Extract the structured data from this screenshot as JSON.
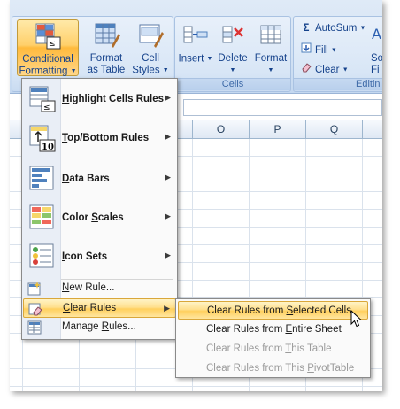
{
  "ribbon": {
    "groups": [
      {
        "label": "Cells"
      },
      {
        "label": "Editin"
      }
    ],
    "buttons": {
      "conditional_formatting": {
        "line1": "Conditional",
        "line2": "Formatting",
        "icon": "conditional-formatting-icon"
      },
      "format_as_table": {
        "line1": "Format",
        "line2": "as Table",
        "icon": "format-as-table-icon"
      },
      "cell_styles": {
        "line1": "Cell",
        "line2": "Styles",
        "icon": "cell-styles-icon"
      },
      "insert": {
        "label": "Insert",
        "icon": "insert-cells-icon"
      },
      "delete": {
        "label": "Delete",
        "icon": "delete-cells-icon"
      },
      "format": {
        "label": "Format",
        "icon": "format-cells-icon"
      },
      "autosum": {
        "label": "AutoSum",
        "glyph": "Σ"
      },
      "fill": {
        "label": "Fill"
      },
      "clear": {
        "label": "Clear"
      },
      "sort_partial": {
        "line1": "So",
        "line2": "Fi"
      }
    }
  },
  "grid": {
    "columns": [
      "O",
      "P",
      "Q"
    ]
  },
  "conditional_menu": {
    "items": [
      {
        "pre": "",
        "key": "H",
        "post": "ighlight Cells Rules",
        "has_submenu": true,
        "icon": "highlight-cells-rules-icon"
      },
      {
        "pre": "",
        "key": "T",
        "post": "op/Bottom Rules",
        "has_submenu": true,
        "icon": "top-bottom-rules-icon",
        "icon_text": "10"
      },
      {
        "pre": "",
        "key": "D",
        "post": "ata Bars",
        "has_submenu": true,
        "icon": "data-bars-icon"
      },
      {
        "pre": "Color ",
        "key": "S",
        "post": "cales",
        "has_submenu": true,
        "icon": "color-scales-icon"
      },
      {
        "pre": "",
        "key": "I",
        "post": "con Sets",
        "has_submenu": true,
        "icon": "icon-sets-icon"
      }
    ],
    "small_items": [
      {
        "pre": "",
        "key": "N",
        "post": "ew Rule...",
        "icon": "new-rule-icon"
      },
      {
        "pre": "",
        "key": "C",
        "post": "lear Rules",
        "has_submenu": true,
        "highlighted": true,
        "icon": "clear-rules-icon"
      },
      {
        "pre": "Manage ",
        "key": "R",
        "post": "ules...",
        "icon": "manage-rules-icon"
      }
    ]
  },
  "clear_rules_submenu": {
    "items": [
      {
        "pre": "Clear Rules from ",
        "key": "S",
        "post": "elected Cells",
        "highlighted": true,
        "enabled": true
      },
      {
        "pre": "Clear Rules from ",
        "key": "E",
        "post": "ntire Sheet",
        "enabled": true
      },
      {
        "pre": "Clear Rules from ",
        "key": "T",
        "post": "his Table",
        "enabled": false
      },
      {
        "pre": "Clear Rules from This ",
        "key": "P",
        "post": "ivotTable",
        "enabled": false
      }
    ]
  },
  "colors": {
    "ribbon_text": "#15428b",
    "highlight": "#ffd05e",
    "disabled_text": "#9b9b9b"
  }
}
